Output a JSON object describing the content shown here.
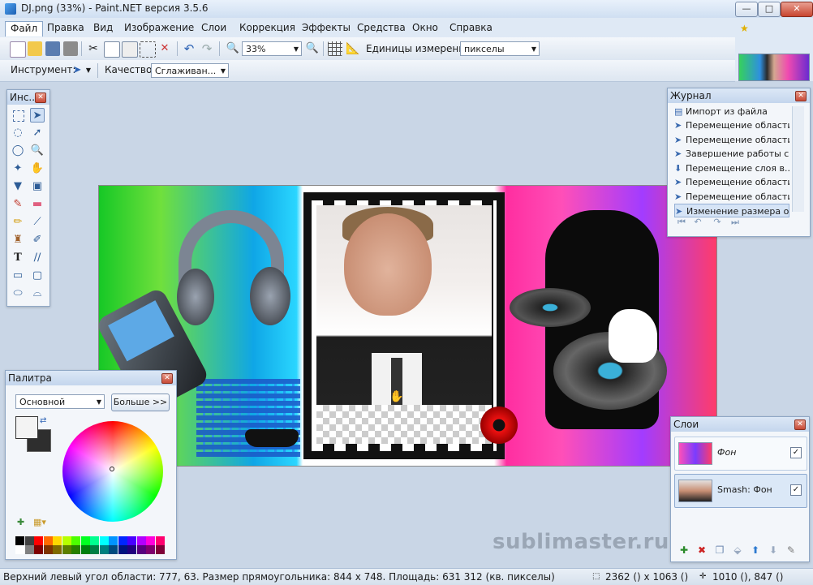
{
  "window": {
    "title": "DJ.png (33%) - Paint.NET версия 3.5.6",
    "controls": {
      "minimize": "—",
      "maximize": "□",
      "close": "✕"
    }
  },
  "menu": [
    "Файл",
    "Правка",
    "Вид",
    "Изображение",
    "Слои",
    "Коррекция",
    "Эффекты",
    "Средства",
    "Окно",
    "Справка"
  ],
  "toolbar": {
    "zoom_value": "33%",
    "units_label": "Единицы измерения:",
    "units_value": "пикселы",
    "tool_label": "Инструмент:",
    "quality_label": "Качество:",
    "quality_value": "Сглаживан..."
  },
  "tools_window": {
    "title": "Инс..."
  },
  "history": {
    "title": "Журнал",
    "items": [
      "Импорт из файла",
      "Перемещение области",
      "Перемещение области",
      "Завершение работы с...",
      "Перемещение слоя в...",
      "Перемещение области",
      "Перемещение области",
      "Изменение размера о..."
    ]
  },
  "palette": {
    "title": "Палитра",
    "mode_value": "Основной",
    "more_button": "Больше >>",
    "colors": [
      "#000000",
      "#404040",
      "#ff0000",
      "#ff6a00",
      "#ffd800",
      "#b6ff00",
      "#4cff00",
      "#00ff21",
      "#00ff90",
      "#00ffff",
      "#0094ff",
      "#0026ff",
      "#4800ff",
      "#b200ff",
      "#ff00dc",
      "#ff006e",
      "#ffffff",
      "#808080",
      "#7f0000",
      "#7f3300",
      "#7f6a00",
      "#5b7f00",
      "#267f00",
      "#007f0e",
      "#007f46",
      "#007f7f",
      "#004a7f",
      "#00137f",
      "#21007f",
      "#57007f",
      "#7f006e",
      "#7f0037"
    ]
  },
  "layers": {
    "title": "Слои",
    "items": [
      {
        "name": "Фон",
        "visible": true
      },
      {
        "name": "Smash: Фон",
        "visible": true
      }
    ]
  },
  "watermark": "sublimaster.ru",
  "status": {
    "info": "Верхний левый угол области: 777, 63. Размер прямоугольника: 844 x 748. Площадь: 631 312 (кв. пикселы)",
    "image_size": "2362 () x 1063 ()",
    "cursor_pos": "1010 (), 847 ()"
  }
}
